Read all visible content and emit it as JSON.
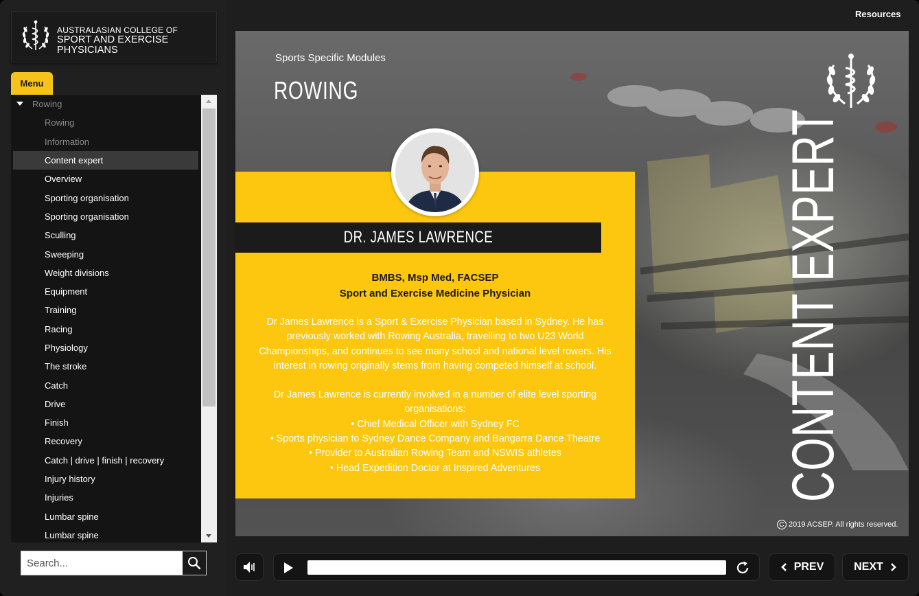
{
  "app": {
    "logo": {
      "line1": "AUSTRALASIAN COLLEGE OF",
      "line2": "SPORT AND EXERCISE PHYSICIANS",
      "emblem": "caduceus-laurel-emblem"
    },
    "resources_label": "Resources"
  },
  "sidebar": {
    "menu_tab_label": "Menu",
    "items": [
      {
        "label": "Rowing",
        "type": "parent"
      },
      {
        "label": "Rowing",
        "type": "dim"
      },
      {
        "label": "Information",
        "type": "dim"
      },
      {
        "label": "Content expert",
        "type": "selected"
      },
      {
        "label": "Overview"
      },
      {
        "label": "Sporting organisation"
      },
      {
        "label": "Sporting organisation"
      },
      {
        "label": "Sculling"
      },
      {
        "label": "Sweeping"
      },
      {
        "label": "Weight divisions"
      },
      {
        "label": "Equipment"
      },
      {
        "label": "Training"
      },
      {
        "label": "Racing"
      },
      {
        "label": "Physiology"
      },
      {
        "label": "The stroke"
      },
      {
        "label": "Catch"
      },
      {
        "label": "Drive"
      },
      {
        "label": "Finish"
      },
      {
        "label": "Recovery"
      },
      {
        "label": "Catch | drive | finish | recovery"
      },
      {
        "label": "Injury history"
      },
      {
        "label": "Injuries"
      },
      {
        "label": "Lumbar spine"
      },
      {
        "label": "Lumbar spine"
      }
    ],
    "search": {
      "placeholder": "Search...",
      "value": "",
      "icon": "search-icon"
    }
  },
  "slide": {
    "subtitle": "Sports Specific Modules",
    "title": "ROWING",
    "vertical_title": "CONTENT EXPERT",
    "expert": {
      "name": "DR. JAMES LAWRENCE",
      "credentials": "BMBS, Msp Med, FACSEP",
      "role": "Sport and Exercise Medicine Physician",
      "bio_paragraph_1": "Dr James Lawrence is a Sport & Exercise Physician based in Sydney. He has previously worked with Rowing Australia, travelling to two U23 World Championships, and continues to see many school and national level rowers. His interest in rowing originally stems from having competed himself at school.",
      "bio_paragraph_2": "Dr James Lawrence is currently involved in a number of elite level sporting organisations:",
      "bullets": [
        "Chief Medical Officer with Sydney FC",
        "Sports physician to Sydney Dance Company and Bangarra Dance Theatre",
        "Provider to Australian Rowing Team and NSWIS athletes",
        "Head Expedition Doctor at Inspired Adventures"
      ]
    },
    "copyright": "2019 ACSEP. All rights reserved.",
    "accent_color": "#fcc70e"
  },
  "controls": {
    "volume_icon": "volume-icon",
    "play_icon": "play-icon",
    "replay_icon": "replay-icon",
    "progress": 0,
    "prev_label": "PREV",
    "next_label": "NEXT"
  }
}
